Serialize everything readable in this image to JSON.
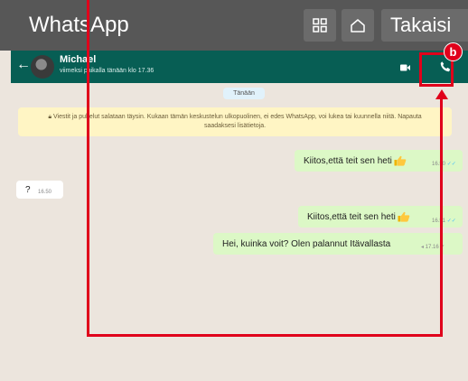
{
  "device": {
    "title": "WhatsApp",
    "back_label": "Takaisi",
    "grid_icon": "grid-icon",
    "home_icon": "home-icon"
  },
  "header": {
    "contact_name": "Michael",
    "status": "viimeksi paikalla tänään klo 17.36",
    "back_icon": "arrow-left-icon",
    "video_icon": "video-call-icon",
    "call_icon": "phone-call-icon",
    "menu_icon": "more-vertical-icon"
  },
  "chat": {
    "date_chip": "Tänään",
    "encryption_notice": "Viestit ja puhelut salataan täysin. Kukaan tämän keskustelun ulkopuolinen, ei edes WhatsApp, voi lukea tai kuunnella niitä. Napauta saadaksesi lisätietoja.",
    "messages": [
      {
        "direction": "out",
        "text": "Kiitos,että teit sen heti",
        "emoji": "thumbs-up",
        "time": "16.50",
        "ticks": "✓✓"
      },
      {
        "direction": "in",
        "text": "?",
        "time": "16.50"
      },
      {
        "direction": "out",
        "text": "Kiitos,että teit sen heti",
        "emoji": "thumbs-up",
        "time": "16.51",
        "ticks": "✓✓"
      },
      {
        "direction": "out",
        "text": "Hei, kuinka voit? Olen palannut Itävallasta",
        "time": "17.16",
        "ticks": "✓"
      }
    ]
  },
  "overlay": {
    "badge_letter": "b",
    "color": "#e0001b"
  },
  "colors": {
    "whatsapp_green": "#075e54",
    "bubble_out": "#dcf8c6",
    "chat_bg": "#ece5dd",
    "device_bar": "#575757"
  }
}
